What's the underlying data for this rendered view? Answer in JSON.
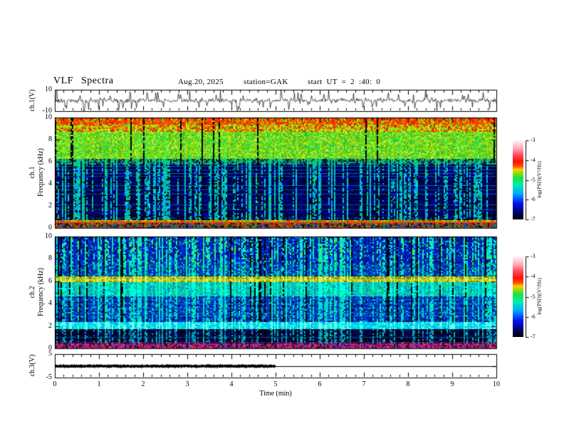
{
  "title": {
    "main": "VLF  Spectra",
    "date": "Aug.20,  2025",
    "station": "station=GAK",
    "start_ut": "start  UT  =   2 :40: 0"
  },
  "x_axis": {
    "label": "Time   (min)",
    "ticks": [
      "0",
      "1",
      "2",
      "3",
      "4",
      "5",
      "6",
      "7",
      "8",
      "9",
      "10"
    ]
  },
  "panels": {
    "ch1_wave": {
      "ylabel": "ch.1(V)",
      "yticks": [
        "10",
        "-10"
      ]
    },
    "ch1_spec": {
      "ylabel_channel": "ch.1",
      "ylabel_axis": "Frequency  (kHz)",
      "yticks": [
        "10",
        "8",
        "6",
        "4",
        "2",
        "0"
      ]
    },
    "ch2_spec": {
      "ylabel_channel": "ch.2",
      "ylabel_axis": "Frequency  (kHz)",
      "yticks": [
        "10",
        "8",
        "6",
        "4",
        "2",
        "0"
      ]
    },
    "ch3": {
      "ylabel": "ch.3(V)",
      "yticks": [
        "5",
        "-5"
      ]
    }
  },
  "colorbars": [
    {
      "label": "log(PSD)(V²/Hz)",
      "ticks": [
        "-3",
        "-4",
        "-5",
        "-6",
        "-7"
      ]
    },
    {
      "label": "log(PSD)(V²/Hz)",
      "ticks": [
        "-3",
        "-4",
        "-5",
        "-6",
        "-7"
      ]
    }
  ],
  "colormap_stops": [
    [
      0.0,
      "#000000"
    ],
    [
      0.07,
      "#000055"
    ],
    [
      0.2,
      "#0011ee"
    ],
    [
      0.33,
      "#00aaff"
    ],
    [
      0.44,
      "#00eeaa"
    ],
    [
      0.53,
      "#22dd44"
    ],
    [
      0.59,
      "#99dd00"
    ],
    [
      0.63,
      "#ffcc00"
    ],
    [
      0.67,
      "#ff5500"
    ],
    [
      0.73,
      "#ff1100"
    ],
    [
      0.81,
      "#ff4455"
    ],
    [
      0.9,
      "#ffaabb"
    ],
    [
      1.0,
      "#fff5f5"
    ]
  ],
  "chart_data": [
    {
      "id": "ch1_raw_signal",
      "type": "line",
      "title": "ch.1 raw signal",
      "ylabel": "ch.1(V)",
      "x_range_min": [
        0,
        10
      ],
      "y_range_v": [
        -10,
        10
      ],
      "baseline_v": 0,
      "noise_amp_v": 1.3,
      "n_spikes": 80,
      "spike_amp_v": [
        3,
        9
      ],
      "color": "#000000",
      "description": "continuous broadband VLF noise centred on 0 V with impulsive sferic spikes in both polarities"
    },
    {
      "id": "ch1_spectrogram",
      "type": "heatmap",
      "x_range_min": [
        0,
        10
      ],
      "y_range_khz": [
        0,
        10
      ],
      "z_label": "log(PSD)(V²/Hz)",
      "z_range": [
        -7,
        -3
      ],
      "stripe_density": 0.45,
      "gap_density": 0.06,
      "bands": [
        {
          "f": [
            9.3,
            10
          ],
          "colors": [
            "#dd2200",
            "#ff4400",
            "#ff7700",
            "#aadd00",
            "#88cc11"
          ],
          "weights": [
            3,
            3,
            1,
            2,
            2
          ],
          "stripe": [
            "#ff3300",
            "#ee5500"
          ]
        },
        {
          "f": [
            8.75,
            9.3
          ],
          "colors": [
            "#dd2200",
            "#ff6600",
            "#99dd11",
            "#bbee22",
            "#55bb22"
          ],
          "weights": [
            2,
            2,
            3,
            2,
            1
          ],
          "stripe": [
            "#ff4400",
            "#99ee00"
          ]
        },
        {
          "f": [
            6.3,
            8.75
          ],
          "colors": [
            "#99dd11",
            "#77cc00",
            "#bbee33",
            "#33bb33",
            "#55cc44"
          ],
          "weights": [
            3,
            3,
            2,
            2,
            2
          ],
          "stripe": [
            "#33dd44",
            "#88ee22"
          ]
        },
        {
          "f": [
            5.7,
            6.3
          ],
          "colors": [
            "#33aa55",
            "#118866",
            "#003355",
            "#00aa88",
            "#001144"
          ],
          "weights": [
            2,
            2,
            2,
            1,
            2
          ],
          "stripe": [
            "#00cc88"
          ]
        },
        {
          "f": [
            1.0,
            5.7
          ],
          "colors": [
            "#000022",
            "#000044",
            "#000077",
            "#0000bb",
            "#001655"
          ],
          "weights": [
            4,
            3,
            3,
            2,
            1
          ],
          "stripe": [
            "#00bb99",
            "#00ddcc",
            "#00cc55",
            "#0099ff"
          ]
        },
        {
          "f": [
            0.75,
            1.0
          ],
          "colors": [
            "#000033",
            "#003344",
            "#005544",
            "#0000aa"
          ],
          "weights": [
            3,
            1,
            1,
            1
          ],
          "stripe": [
            "#00cc88"
          ]
        },
        {
          "f": [
            0.4,
            0.75
          ],
          "colors": [
            "#ff8800",
            "#ffcc00",
            "#dd3300",
            "#88cc00",
            "#33bb44",
            "#ff5500"
          ],
          "weights": [
            2,
            2,
            2,
            3,
            2,
            1
          ],
          "gap": false
        },
        {
          "f": [
            0,
            0.4
          ],
          "colors": [
            "#cc2200",
            "#228833",
            "#2244cc",
            "#101010",
            "#995500",
            "#cc7700"
          ],
          "weights": [
            2,
            2,
            2,
            2,
            1,
            1
          ],
          "gap": false
        }
      ],
      "hlines": [
        {
          "f": 5.6,
          "color": "#00bbee",
          "alpha": 0.5
        },
        {
          "f": 5.3,
          "color": "#00bbee",
          "alpha": 0.45
        },
        {
          "f": 5.0,
          "color": "#00bbee",
          "alpha": 0.5
        },
        {
          "f": 4.7,
          "color": "#00bbee",
          "alpha": 0.4
        },
        {
          "f": 3.9,
          "color": "#00bbee",
          "alpha": 0.5
        },
        {
          "f": 3.5,
          "color": "#00bbee",
          "alpha": 0.4
        },
        {
          "f": 3.1,
          "color": "#00bbee",
          "alpha": 0.45
        },
        {
          "f": 2.1,
          "color": "#00bbee",
          "alpha": 0.4
        },
        {
          "f": 1.7,
          "color": "#00bbee",
          "alpha": 0.35
        },
        {
          "f": 0.6,
          "color": "#ff3300",
          "alpha": 0.85,
          "w": 2
        }
      ],
      "description": "sferic-dominated spectrogram: red/yellow-green above ~6.3 kHz, dark blue background with dense vertical cyan/green sferic stripes below, bright power-line band near 0.6 kHz"
    },
    {
      "id": "ch2_spectrogram",
      "type": "heatmap",
      "x_range_min": [
        0,
        10
      ],
      "y_range_khz": [
        0,
        10
      ],
      "z_label": "log(PSD)(V²/Hz)",
      "z_range": [
        -7,
        -3
      ],
      "stripe_density": 0.5,
      "gap_density": 0.06,
      "bands": [
        {
          "f": [
            7.6,
            10
          ],
          "colors": [
            "#0022bb",
            "#0033ee",
            "#001188",
            "#000f66",
            "#00bb99"
          ],
          "weights": [
            3,
            2,
            2,
            1,
            1
          ],
          "stripe": [
            "#00ee99",
            "#44ee44",
            "#00ccff",
            "#00ffcc"
          ]
        },
        {
          "f": [
            6.4,
            7.6
          ],
          "colors": [
            "#0033cc",
            "#0066cc",
            "#00aaaa",
            "#002299"
          ],
          "weights": [
            2,
            1,
            1,
            2
          ],
          "stripe": [
            "#00dd99",
            "#00eebb"
          ]
        },
        {
          "f": [
            5.9,
            6.4
          ],
          "colors": [
            "#aacc11",
            "#88aa00",
            "#ccdd44",
            "#bb5511",
            "#669900"
          ],
          "weights": [
            3,
            2,
            2,
            1,
            2
          ],
          "stripe": [
            "#ddee44"
          ],
          "gap": false
        },
        {
          "f": [
            4.7,
            5.9
          ],
          "colors": [
            "#00ccaa",
            "#00bbdd",
            "#22cc66",
            "#0088cc",
            "#00eecc"
          ],
          "weights": [
            3,
            2,
            2,
            2,
            1
          ],
          "stripe": [
            "#00ffdd"
          ]
        },
        {
          "f": [
            2.4,
            4.7
          ],
          "colors": [
            "#0033bb",
            "#002299",
            "#0044dd",
            "#00aacc",
            "#001177"
          ],
          "weights": [
            3,
            2,
            2,
            1,
            2
          ],
          "stripe": [
            "#00ccdd",
            "#00eeaa"
          ]
        },
        {
          "f": [
            1.7,
            2.4
          ],
          "colors": [
            "#00eedd",
            "#00ccff",
            "#33ffcc",
            "#00aaee"
          ],
          "weights": [
            3,
            2,
            1,
            2
          ],
          "gap": false,
          "stripe": [
            "#66ffee"
          ]
        },
        {
          "f": [
            0.45,
            1.7
          ],
          "colors": [
            "#000022",
            "#000044",
            "#000a55",
            "#000000",
            "#001188"
          ],
          "weights": [
            3,
            3,
            2,
            2,
            1
          ],
          "stripe": [
            "#00bbaa",
            "#0066aa"
          ]
        },
        {
          "f": [
            0,
            0.45
          ],
          "colors": [
            "#bb1177",
            "#dd2244",
            "#5533bb",
            "#111122",
            "#cc4499"
          ],
          "weights": [
            3,
            2,
            2,
            2,
            1
          ],
          "gap": false
        }
      ],
      "hlines": [
        {
          "f": 4.4,
          "color": "#00bbdd",
          "alpha": 0.4
        },
        {
          "f": 4.0,
          "color": "#00bbdd",
          "alpha": 0.5
        },
        {
          "f": 3.6,
          "color": "#00bbdd",
          "alpha": 0.45
        },
        {
          "f": 3.2,
          "color": "#00bbdd",
          "alpha": 0.5
        },
        {
          "f": 2.9,
          "color": "#00bbdd",
          "alpha": 0.4
        },
        {
          "f": 1.05,
          "color": "#00aacc",
          "alpha": 0.45
        },
        {
          "f": 6.15,
          "color": "#ffee66",
          "alpha": 0.35,
          "w": 2
        },
        {
          "f": 0.6,
          "color": "#cc2255",
          "alpha": 0.6
        }
      ],
      "description": "bluer spectrogram: blue with green sferic stripes above 7.6 kHz, olive band near 6.1 kHz, cyan-green 4.7-5.9 kHz, bright cyan band near 2 kHz, dark below, magenta edge band at bottom"
    },
    {
      "id": "ch3_raw_signal",
      "type": "line",
      "title": "ch.3 raw signal",
      "ylabel": "ch.3(V)",
      "x_range_min": [
        0,
        10
      ],
      "y_range_v": [
        -5,
        5
      ],
      "segments": [
        {
          "t_min": [
            0,
            5
          ],
          "value_v": 0,
          "style": "thick-noisy"
        },
        {
          "t_min": [
            5,
            10
          ],
          "value_v": 0,
          "style": "thin-flat"
        }
      ],
      "color": "#000000",
      "description": "near-zero trace: noisy thick line 0-5 min, flat thin line 5-10 min"
    }
  ]
}
